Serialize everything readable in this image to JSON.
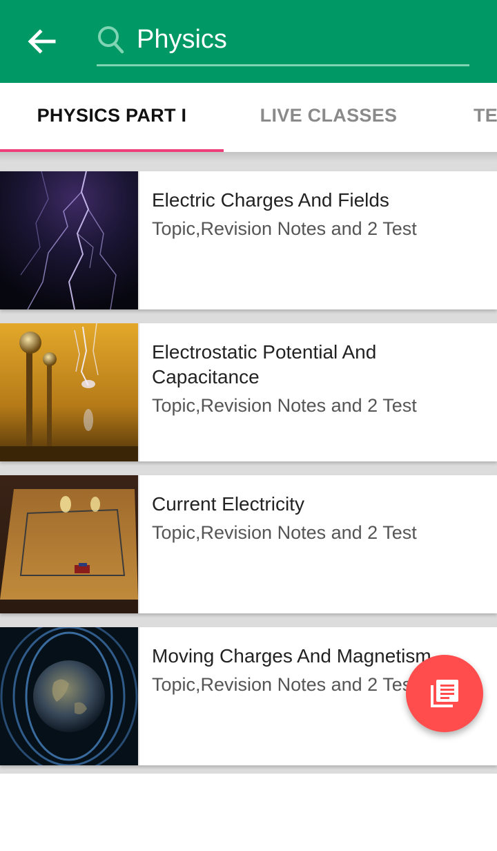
{
  "colors": {
    "appbar": "#009966",
    "tab_indicator": "#ee3f7a",
    "fab": "#ff4d4d"
  },
  "header": {
    "back_icon": "arrow-back-icon",
    "search_icon": "search-icon",
    "search_value": "Physics"
  },
  "tabs": [
    {
      "label": "PHYSICS PART I",
      "active": true
    },
    {
      "label": "LIVE CLASSES",
      "active": false
    },
    {
      "label": "TE",
      "active": false
    }
  ],
  "chapters": [
    {
      "title": "Electric Charges And Fields",
      "subtitle": "Topic,Revision Notes and 2 Test",
      "thumbnail": "lightning-image"
    },
    {
      "title": "Electrostatic Potential And Capacitance",
      "subtitle": "Topic,Revision Notes and 2 Test",
      "thumbnail": "van-de-graaff-image"
    },
    {
      "title": "Current Electricity",
      "subtitle": "Topic,Revision Notes and 2 Test",
      "thumbnail": "circuit-board-image"
    },
    {
      "title": "Moving Charges And Magnetism",
      "subtitle": "Topic,Revision Notes and 2 Test",
      "thumbnail": "earth-magnetic-field-image"
    }
  ],
  "fab": {
    "icon": "library-books-icon"
  }
}
